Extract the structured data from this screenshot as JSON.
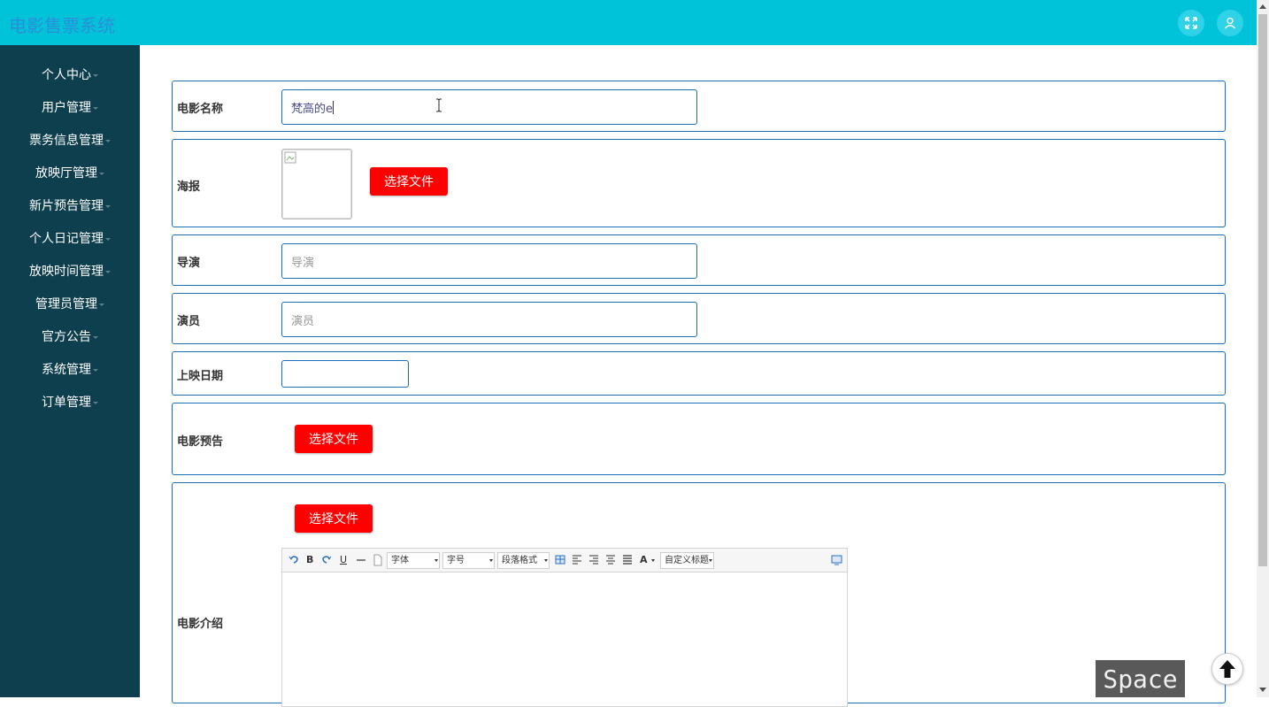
{
  "app": {
    "title": "电影售票系统"
  },
  "header": {
    "icons": [
      "fullscreen-icon",
      "user-icon"
    ]
  },
  "sidebar": {
    "items": [
      {
        "label": "个人中心"
      },
      {
        "label": "用户管理"
      },
      {
        "label": "票务信息管理"
      },
      {
        "label": "放映厅管理"
      },
      {
        "label": "新片预告管理"
      },
      {
        "label": "个人日记管理"
      },
      {
        "label": "放映时间管理"
      },
      {
        "label": "管理员管理"
      },
      {
        "label": "官方公告"
      },
      {
        "label": "系统管理"
      },
      {
        "label": "订单管理"
      }
    ]
  },
  "form": {
    "movie_name": {
      "label": "电影名称",
      "value": "梵高的e"
    },
    "poster": {
      "label": "海报",
      "button": "选择文件"
    },
    "director": {
      "label": "导演",
      "placeholder": "导演"
    },
    "actors": {
      "label": "演员",
      "placeholder": "演员"
    },
    "release_date": {
      "label": "上映日期",
      "value": ""
    },
    "trailer": {
      "label": "电影预告",
      "button": "选择文件"
    },
    "intro": {
      "label": "电影介绍",
      "button": "选择文件",
      "toolbar": {
        "font_family": "字体",
        "font_size": "字号",
        "paragraph": "段落格式",
        "custom_title": "自定义标题",
        "bold": "B",
        "underline": "U",
        "font_color": "A"
      }
    }
  },
  "overlay": {
    "key_badge": "Space"
  },
  "colors": {
    "topbar": "#00c3da",
    "sidebar": "#0e3f4f",
    "accent_border": "#1a6fb8",
    "button_red": "#ff0000"
  }
}
